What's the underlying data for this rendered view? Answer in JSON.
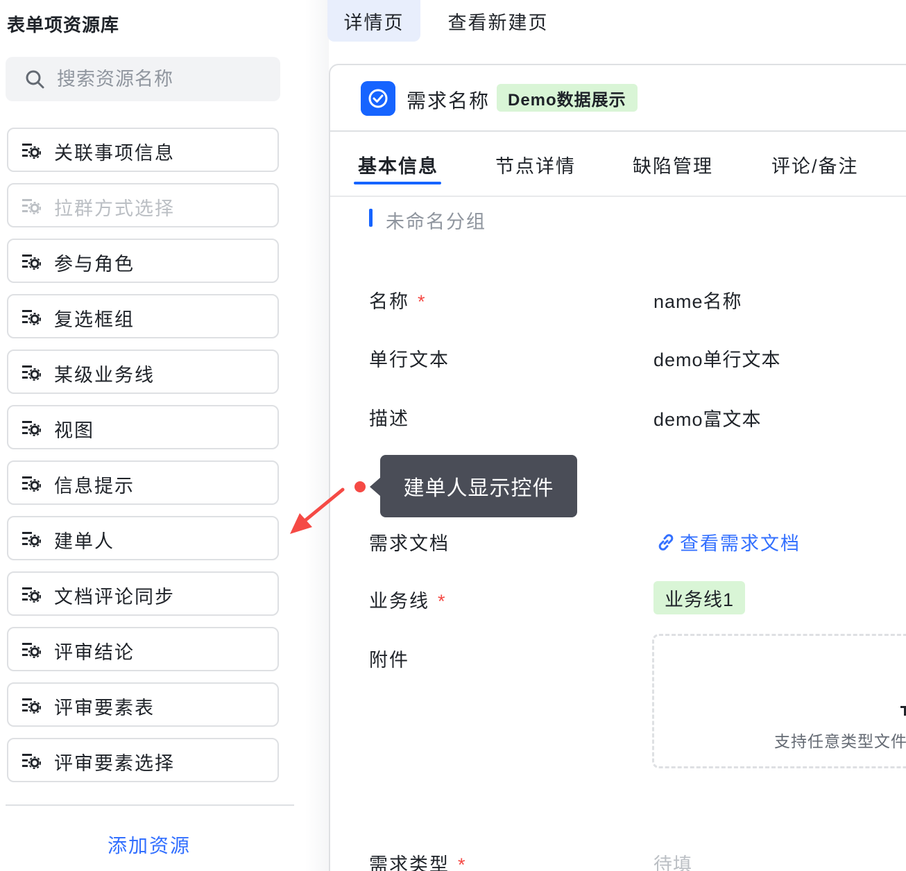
{
  "sidebar": {
    "title": "表单项资源库",
    "search_placeholder": "搜索资源名称",
    "items": [
      {
        "label": "关联事项信息",
        "disabled": false
      },
      {
        "label": "拉群方式选择",
        "disabled": true
      },
      {
        "label": "参与角色",
        "disabled": false
      },
      {
        "label": "复选框组",
        "disabled": false
      },
      {
        "label": "某级业务线",
        "disabled": false
      },
      {
        "label": "视图",
        "disabled": false
      },
      {
        "label": "信息提示",
        "disabled": false
      },
      {
        "label": "建单人",
        "disabled": false
      },
      {
        "label": "文档评论同步",
        "disabled": false
      },
      {
        "label": "评审结论",
        "disabled": false
      },
      {
        "label": "评审要素表",
        "disabled": false
      },
      {
        "label": "评审要素选择",
        "disabled": false
      }
    ],
    "add_button": "添加资源"
  },
  "page_tabs": [
    {
      "label": "详情页",
      "active": true
    },
    {
      "label": "查看新建页",
      "active": false
    }
  ],
  "header": {
    "title": "需求名称",
    "badge": "Demo数据展示",
    "icon": "check-circle-icon"
  },
  "detail_tabs": [
    "基本信息",
    "节点详情",
    "缺陷管理",
    "评论/备注"
  ],
  "group_title": "未命名分组",
  "fields": {
    "name": {
      "label": "名称",
      "required": "*",
      "value": "name名称"
    },
    "single_text": {
      "label": "单行文本",
      "value": "demo单行文本"
    },
    "description": {
      "label": "描述",
      "value": "demo富文本"
    },
    "doc": {
      "label": "需求文档",
      "value": "查看需求文档"
    },
    "business_line": {
      "label": "业务线",
      "required": "*",
      "value": "业务线1"
    },
    "attachment": {
      "label": "附件",
      "hint": "支持任意类型文件"
    },
    "req_type": {
      "label": "需求类型",
      "required": "*",
      "value": "待填"
    }
  },
  "tooltip": "建单人显示控件",
  "colors": {
    "accent": "#1664ff",
    "link": "#3370ff",
    "required": "#f54a45",
    "tag_bg": "#d9f5d6"
  }
}
